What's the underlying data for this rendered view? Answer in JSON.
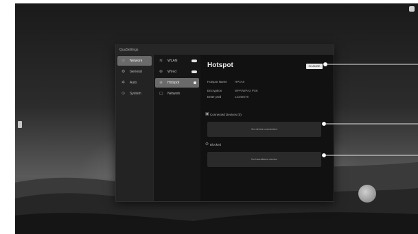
{
  "window": {
    "title": "QuaSettings"
  },
  "nav": {
    "items": [
      {
        "label": "Network",
        "icon": "network-icon",
        "active": true
      },
      {
        "label": "General",
        "icon": "gear-icon",
        "active": false
      },
      {
        "label": "Auto",
        "icon": "auto-icon",
        "active": false
      },
      {
        "label": "System",
        "icon": "system-icon",
        "active": false
      }
    ]
  },
  "subnav": {
    "items": [
      {
        "label": "WLAN",
        "icon": "wifi-icon",
        "active": false
      },
      {
        "label": "Wired",
        "icon": "wired-icon",
        "active": false
      },
      {
        "label": "Hotspot",
        "icon": "hotspot-icon",
        "active": true
      },
      {
        "label": "Network",
        "icon": "network-icon",
        "active": false
      }
    ]
  },
  "hotspot": {
    "title": "Hotspot",
    "change_label": "CHANGE",
    "info": [
      {
        "key": "Hotspot Name",
        "value": "HP4A0"
      },
      {
        "key": "Encryption",
        "value": "WPA/WPA2 PSK"
      },
      {
        "key": "Enter pwd",
        "value": "12345678"
      }
    ],
    "connected_label": "Connected Devices (0)",
    "connected_empty": "No device connected",
    "blocked_label": "Blocked",
    "blocked_empty": "No blacklisted device"
  },
  "colors": {
    "accent": "#6a6a6a",
    "window_bg": "#1b1b1b",
    "button_bg": "#e8e8e8"
  }
}
